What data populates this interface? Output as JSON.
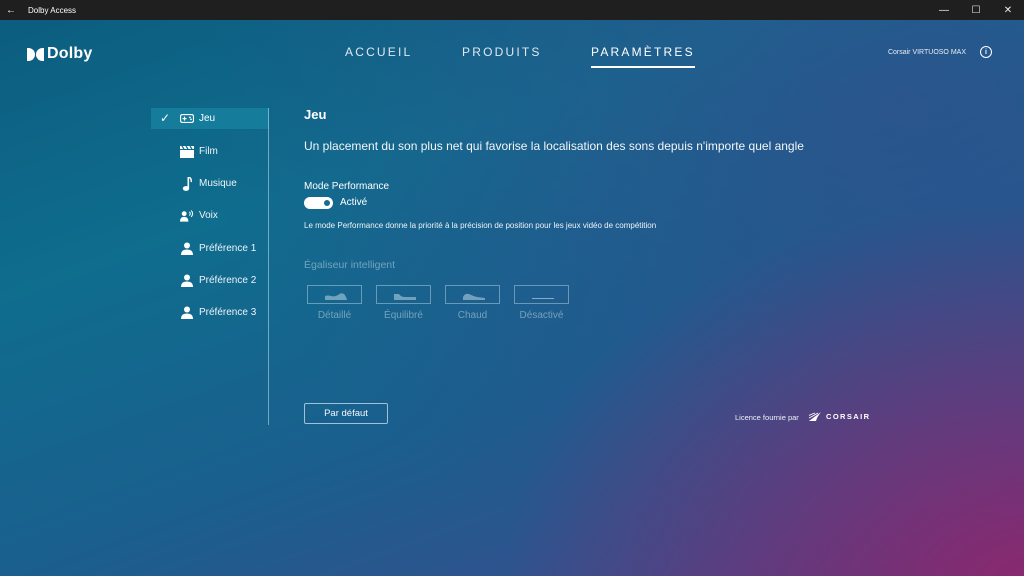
{
  "window": {
    "title": "Dolby Access",
    "back_glyph": "←",
    "minimize_glyph": "—",
    "maximize_glyph": "☐",
    "close_glyph": "✕"
  },
  "header": {
    "logo_text": "Dolby",
    "nav": [
      {
        "label": "ACCUEIL",
        "active": false
      },
      {
        "label": "PRODUITS",
        "active": false
      },
      {
        "label": "PARAMÈTRES",
        "active": true
      }
    ],
    "device": "Corsair VIRTUOSO MAX",
    "info_glyph": "i"
  },
  "sidebar": {
    "items": [
      {
        "label": "Jeu",
        "icon": "gamepad-icon",
        "active": true
      },
      {
        "label": "Film",
        "icon": "clapperboard-icon",
        "active": false
      },
      {
        "label": "Musique",
        "icon": "music-note-icon",
        "active": false
      },
      {
        "label": "Voix",
        "icon": "voice-icon",
        "active": false
      },
      {
        "label": "Préférence 1",
        "icon": "person-icon",
        "active": false
      },
      {
        "label": "Préférence 2",
        "icon": "person-icon",
        "active": false
      },
      {
        "label": "Préférence 3",
        "icon": "person-icon",
        "active": false
      }
    ]
  },
  "main": {
    "title": "Jeu",
    "description": "Un placement du son plus net qui favorise la localisation des sons depuis n'importe quel angle",
    "performance": {
      "label": "Mode Performance",
      "state": "Activé",
      "enabled": true,
      "description": "Le mode Performance donne la priorité à la précision de position pour les jeux vidéo de compétition"
    },
    "equalizer": {
      "title": "Égaliseur intelligent",
      "presets": [
        {
          "label": "Détaillé",
          "icon": "eq-detailed-icon"
        },
        {
          "label": "Équilibré",
          "icon": "eq-balanced-icon"
        },
        {
          "label": "Chaud",
          "icon": "eq-warm-icon"
        },
        {
          "label": "Désactivé",
          "icon": "eq-off-icon"
        }
      ]
    },
    "default_button": "Par défaut",
    "license_text": "Licence fournie par",
    "license_brand": "CORSAIR"
  },
  "colors": {
    "active_item_bg": "#157d9b",
    "titlebar_bg": "#1f1f1f"
  }
}
